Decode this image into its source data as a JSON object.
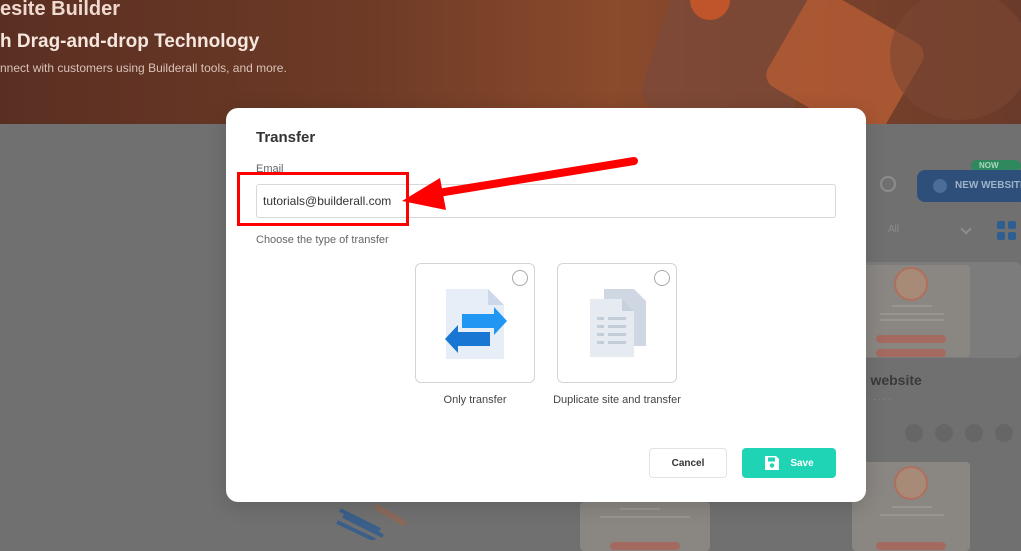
{
  "background": {
    "hero_title": "esite Builder",
    "hero_subtitle": "h Drag-and-drop Technology",
    "hero_text": "nnect with customers using Builderall tools, and more.",
    "badge": "NOW ACT",
    "new_website_button": "NEW WEBSITE",
    "filter_value": "All",
    "website_title": "h website"
  },
  "modal": {
    "title": "Transfer",
    "email_label": "Email",
    "email_value": "tutorials@builderall.com",
    "type_label": "Choose the type of transfer",
    "options": [
      {
        "label": "Only transfer",
        "icon": "transfer-icon",
        "selected": false
      },
      {
        "label": "Duplicate site and transfer",
        "icon": "duplicate-icon",
        "selected": false
      }
    ],
    "cancel_label": "Cancel",
    "save_label": "Save"
  },
  "colors": {
    "accent": "#1fd3b5",
    "annotation": "#ff0000",
    "transfer_blue": "#2196f3"
  }
}
